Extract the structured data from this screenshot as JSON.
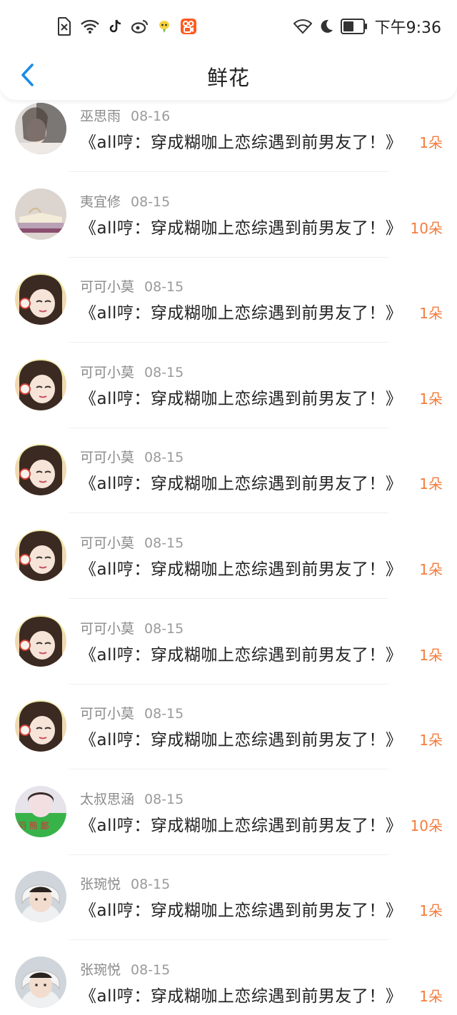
{
  "statusbar": {
    "time": "下午9:36",
    "left_icons": [
      "sim-error-icon",
      "wifi-signal-icon",
      "tiktok-icon",
      "weibo-icon",
      "chat-bubble-icon",
      "kuaishou-icon"
    ],
    "right_icons": [
      "wifi-icon",
      "moon-icon",
      "battery-icon"
    ]
  },
  "navbar": {
    "title": "鲜花"
  },
  "colors": {
    "accent_blue": "#1a8ce8",
    "count_orange": "#f47c3c"
  },
  "items": [
    {
      "user": "巫思雨",
      "date": "08-16",
      "book": "《all哼：穿成糊咖上恋综遇到前男友了！》",
      "count": "1朵",
      "avatar": "avatar-a"
    },
    {
      "user": "夷宜修",
      "date": "08-15",
      "book": "《all哼：穿成糊咖上恋综遇到前男友了！》",
      "count": "10朵",
      "avatar": "avatar-b"
    },
    {
      "user": "可可小莫",
      "date": "08-15",
      "book": "《all哼：穿成糊咖上恋综遇到前男友了！》",
      "count": "1朵",
      "avatar": "avatar-c"
    },
    {
      "user": "可可小莫",
      "date": "08-15",
      "book": "《all哼：穿成糊咖上恋综遇到前男友了！》",
      "count": "1朵",
      "avatar": "avatar-c"
    },
    {
      "user": "可可小莫",
      "date": "08-15",
      "book": "《all哼：穿成糊咖上恋综遇到前男友了！》",
      "count": "1朵",
      "avatar": "avatar-c"
    },
    {
      "user": "可可小莫",
      "date": "08-15",
      "book": "《all哼：穿成糊咖上恋综遇到前男友了！》",
      "count": "1朵",
      "avatar": "avatar-c"
    },
    {
      "user": "可可小莫",
      "date": "08-15",
      "book": "《all哼：穿成糊咖上恋综遇到前男友了！》",
      "count": "1朵",
      "avatar": "avatar-c"
    },
    {
      "user": "可可小莫",
      "date": "08-15",
      "book": "《all哼：穿成糊咖上恋综遇到前男友了！》",
      "count": "1朵",
      "avatar": "avatar-c"
    },
    {
      "user": "太叔思涵",
      "date": "08-15",
      "book": "《all哼：穿成糊咖上恋综遇到前男友了！》",
      "count": "10朵",
      "avatar": "avatar-d"
    },
    {
      "user": "张琬悦",
      "date": "08-15",
      "book": "《all哼：穿成糊咖上恋综遇到前男友了！》",
      "count": "1朵",
      "avatar": "avatar-e"
    },
    {
      "user": "张琬悦",
      "date": "08-15",
      "book": "《all哼：穿成糊咖上恋综遇到前男友了！》",
      "count": "1朵",
      "avatar": "avatar-e"
    }
  ]
}
